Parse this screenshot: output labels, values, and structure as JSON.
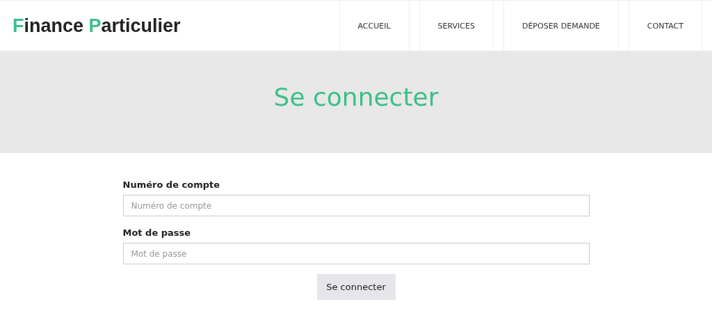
{
  "header": {
    "logo": [
      {
        "initial": "F",
        "rest": "inance"
      },
      {
        "initial": "P",
        "rest": "articulier"
      }
    ],
    "nav": [
      {
        "label": "ACCUEIL"
      },
      {
        "label": "SERVICES"
      },
      {
        "label": "DÉPOSER DEMANDE"
      },
      {
        "label": "CONTACT"
      }
    ]
  },
  "banner": {
    "title": "Se connecter"
  },
  "form": {
    "fields": [
      {
        "label": "Numéro de compte",
        "placeholder": "Numéro de compte"
      },
      {
        "label": "Mot de passe",
        "placeholder": "Mot de passe"
      }
    ],
    "submit": "Se connecter"
  }
}
